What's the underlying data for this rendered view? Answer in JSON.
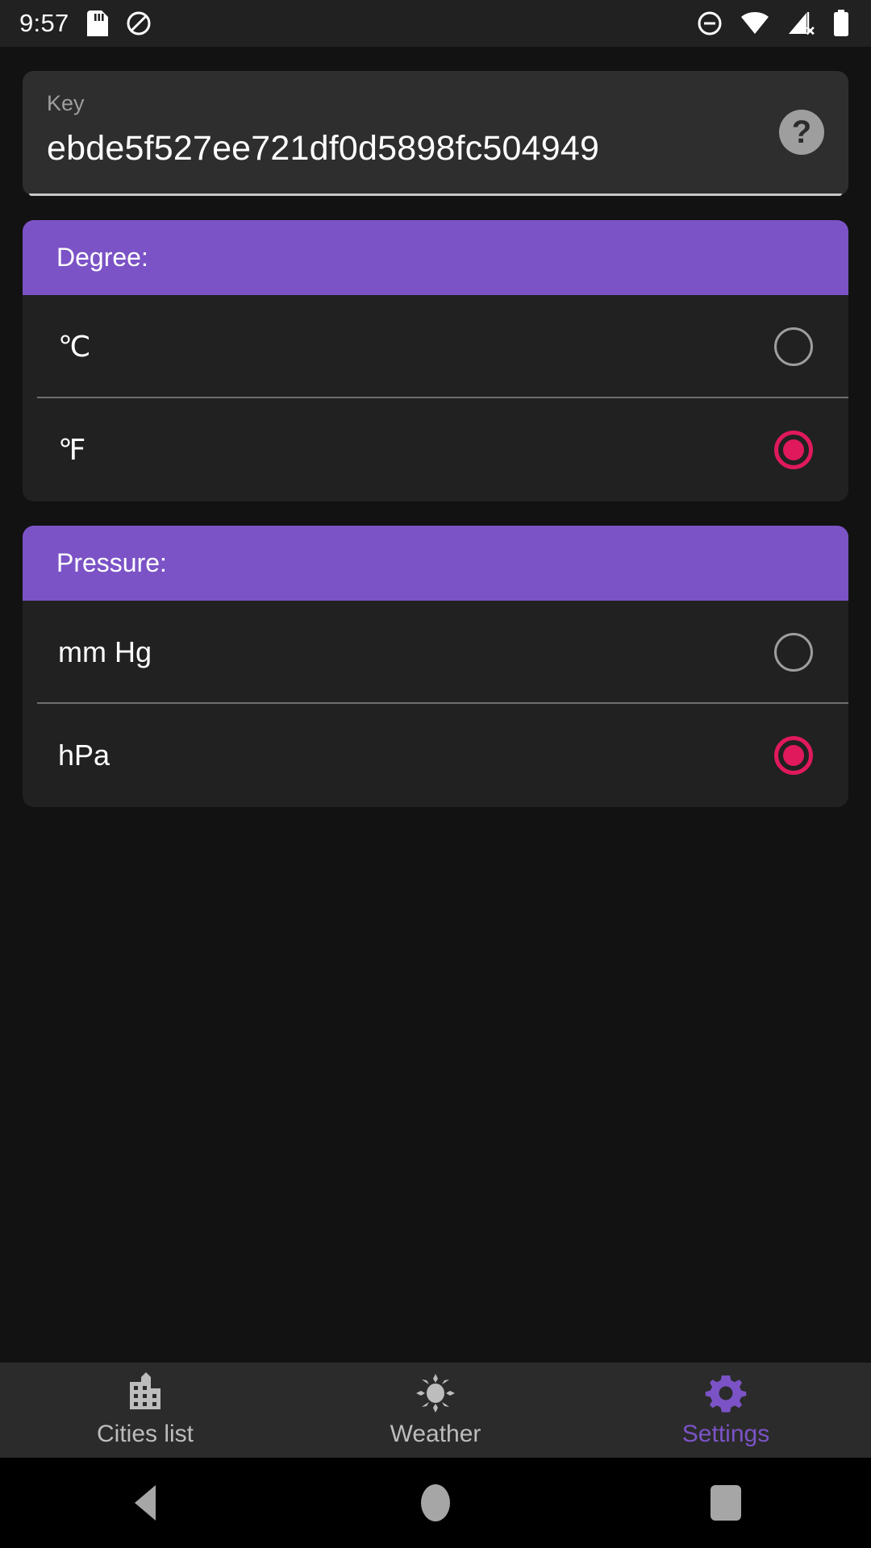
{
  "status_bar": {
    "clock": "9:57",
    "left_icons": [
      "sd-card-icon",
      "do-not-disturb-slash-icon"
    ],
    "right_icons": [
      "dnd-minus-circle-icon",
      "wifi-icon",
      "cellular-no-signal-icon",
      "battery-full-icon"
    ]
  },
  "key_card": {
    "label": "Key",
    "value": "ebde5f527ee721df0d5898fc504949",
    "help_glyph": "?",
    "help_name": "help-question-icon"
  },
  "groups": [
    {
      "id": "degree",
      "header": "Degree:",
      "options": [
        {
          "label": "℃",
          "selected": false
        },
        {
          "label": "℉",
          "selected": true
        }
      ]
    },
    {
      "id": "pressure",
      "header": "Pressure:",
      "options": [
        {
          "label": "mm Hg",
          "selected": false
        },
        {
          "label": "hPa",
          "selected": true
        }
      ]
    }
  ],
  "bottom_nav": {
    "items": [
      {
        "label": "Cities list",
        "icon": "city-buildings-icon",
        "active": false
      },
      {
        "label": "Weather",
        "icon": "sun-icon",
        "active": false
      },
      {
        "label": "Settings",
        "icon": "gear-icon",
        "active": true
      }
    ]
  },
  "system_nav": {
    "back": "back-triangle-icon",
    "home": "home-circle-icon",
    "recents": "recents-square-icon"
  },
  "colors": {
    "accent_purple": "#7b53c6",
    "radio_selected": "#e0195c",
    "page_bg": "#121212",
    "card_bg": "#212121",
    "key_card_bg": "#2e2e2e",
    "nav_bg": "#2b2b2b"
  }
}
